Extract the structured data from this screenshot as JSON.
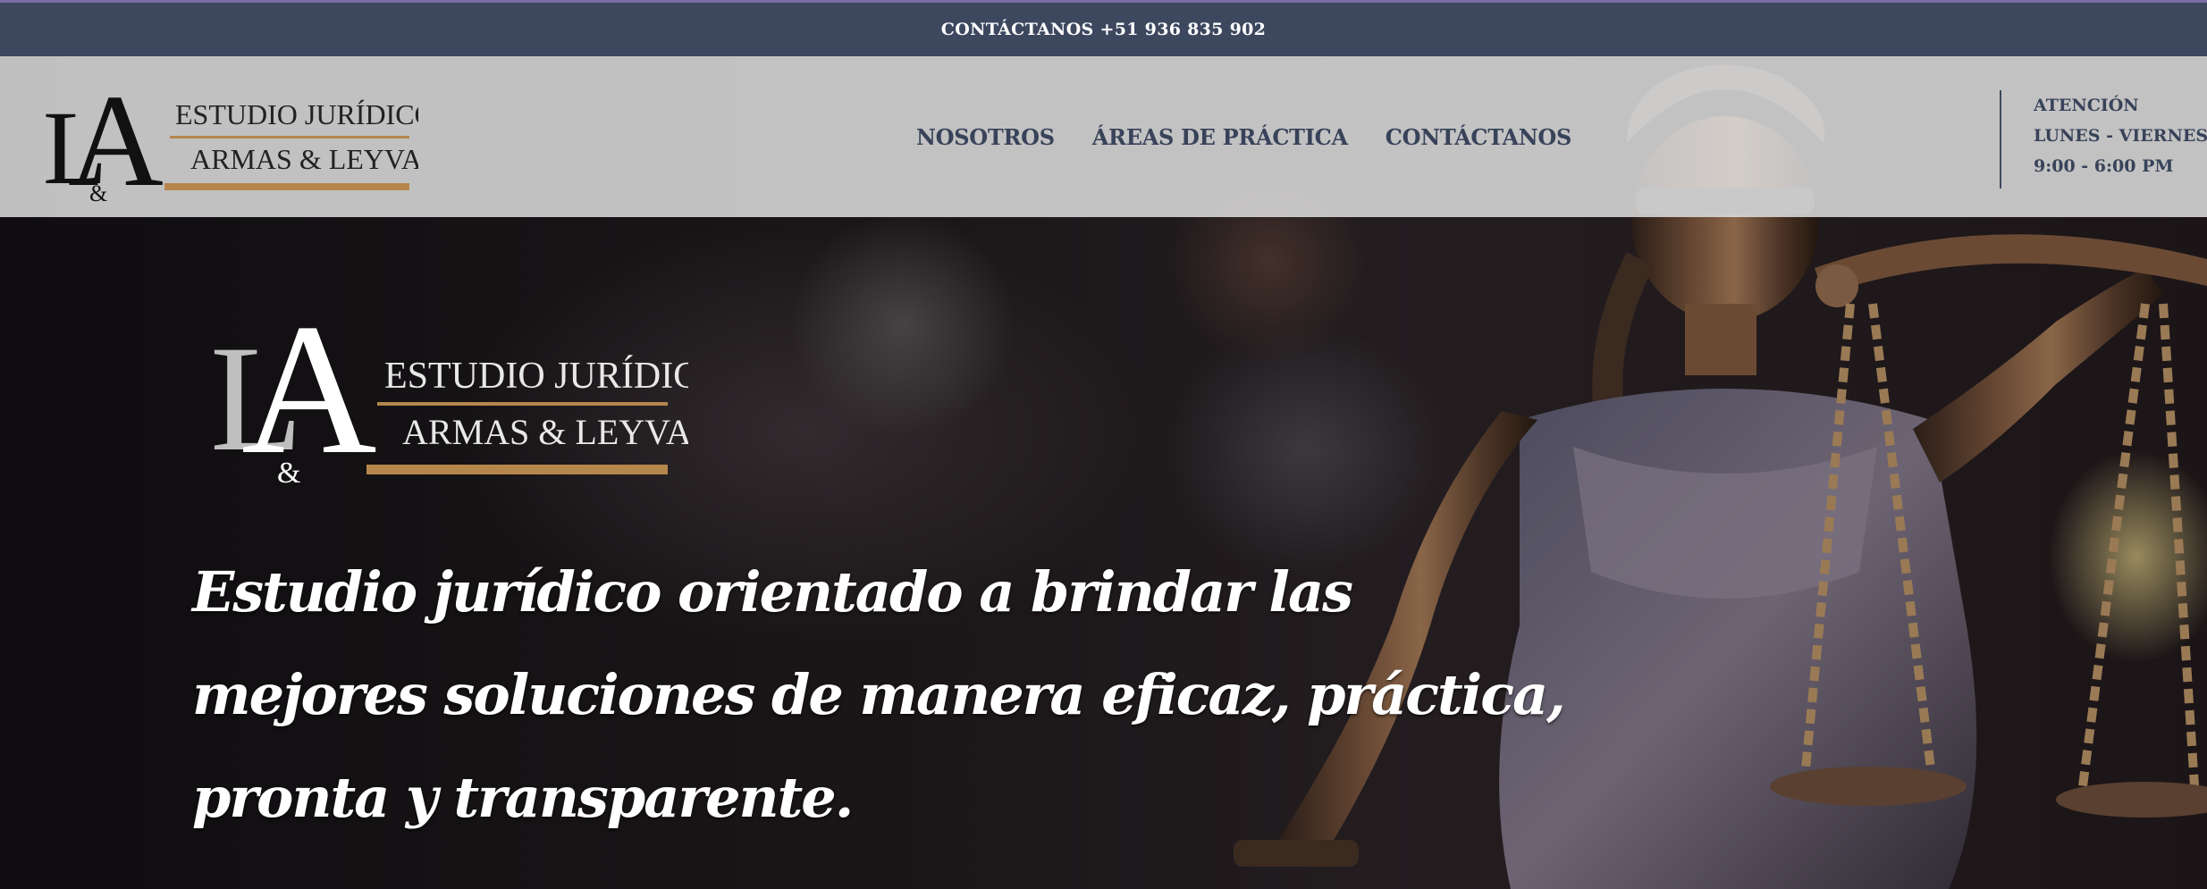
{
  "topbar": {
    "contact_text": "CONTÁCTANOS +51 936 835 902"
  },
  "brand": {
    "monogram_l": "L",
    "monogram_a": "A",
    "monogram_amp": "&",
    "line1": "ESTUDIO JURÍDICO",
    "line2": "ARMAS & LEYVA"
  },
  "nav": {
    "items": [
      {
        "label": "NOSOTROS"
      },
      {
        "label": "ÁREAS DE PRÁCTICA"
      },
      {
        "label": "CONTÁCTANOS"
      }
    ]
  },
  "hours": {
    "title": "ATENCIÓN",
    "days": "LUNES - VIERNES",
    "time": "9:00 - 6:00 PM"
  },
  "hero": {
    "tagline_lines": [
      "Estudio jurídico orientado a brindar las",
      "mejores soluciones de manera eficaz, práctica,",
      "pronta y transparente."
    ],
    "image_icon": "lady-justice-statue-icon"
  },
  "colors": {
    "topbar": "#3d485f",
    "nav_text": "#38435a",
    "brand_gold": "#b5874d",
    "header_bg": "#dedede"
  }
}
